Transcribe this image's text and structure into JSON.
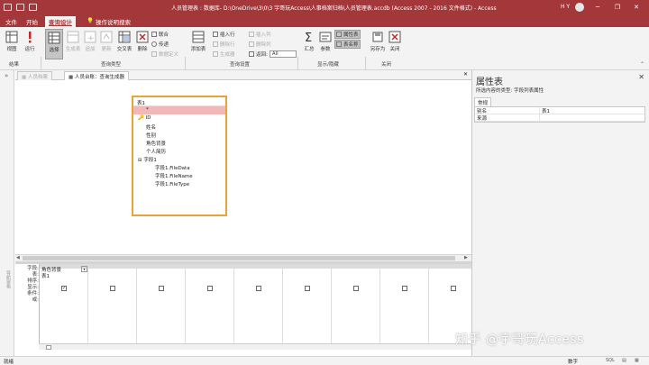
{
  "titlebar": {
    "title": "人员管理表 : 数据库- D:\\OneDrive\\3\\0\\3 宇哥玩Access\\人事档案归档\\人员管理表.accdb (Access 2007 - 2016 文件格式) - Access",
    "user": "H Y",
    "window_buttons": [
      "minimize-icon",
      "restore-icon",
      "close-icon"
    ],
    "accent": "#a4373a"
  },
  "menu_tabs": [
    {
      "label": "文件"
    },
    {
      "label": "开始"
    },
    {
      "label": "查询设计"
    },
    {
      "label": "操作说明搜索"
    }
  ],
  "ribbon": {
    "view_label": "视图",
    "run_label": "运行",
    "select_label": "选择",
    "create_table_label": "生成表",
    "append_label": "追加",
    "update_label": "更新",
    "crosstab_label": "交叉表",
    "delete_label": "删除",
    "union_label": "联合",
    "passthrough_label": "传递",
    "data_definition_label": "数据定义",
    "add_tables_label": "添加表",
    "insert_rows_label": "插入行",
    "delete_rows_label": "删除行",
    "builder_label": "生成器",
    "insert_columns_label": "插入列",
    "delete_columns_label": "删除列",
    "return_label": "返回:",
    "return_value": "All",
    "totals_label": "汇总",
    "parameters_label": "参数",
    "property_sheet_label": "属性表",
    "table_names_label": "表名称",
    "save_as_label": "另存为",
    "close_label": "关闭",
    "groups": [
      "结果",
      "查询类型",
      "查询设置",
      "显示/隐藏",
      "关闭"
    ]
  },
  "nav_pane": {
    "label": "导航窗格"
  },
  "doc_tabs": [
    {
      "label": "人员档案"
    },
    {
      "label": "人员台账：查询生成器"
    }
  ],
  "table_box": {
    "title": "表1",
    "fields": [
      {
        "label": "*"
      },
      {
        "label": "ID"
      },
      {
        "label": "姓名"
      },
      {
        "label": "性别"
      },
      {
        "label": "角色背景"
      },
      {
        "label": "个人简历"
      },
      {
        "label": "字段1"
      },
      {
        "label": "字段1.FileData"
      },
      {
        "label": "字段1.FileName"
      },
      {
        "label": "字段1.FileType"
      }
    ]
  },
  "grid": {
    "row_labels": [
      "字段:",
      "表:",
      "排序:",
      "显示:",
      "条件:",
      "或:"
    ],
    "columns": [
      {
        "field": "角色背景",
        "table": "表1",
        "show": true
      },
      {
        "field": "",
        "table": "",
        "show": false
      },
      {
        "field": "",
        "table": "",
        "show": false
      },
      {
        "field": "",
        "table": "",
        "show": false
      },
      {
        "field": "",
        "table": "",
        "show": false
      },
      {
        "field": "",
        "table": "",
        "show": false
      },
      {
        "field": "",
        "table": "",
        "show": false
      },
      {
        "field": "",
        "table": "",
        "show": false
      },
      {
        "field": "",
        "table": "",
        "show": false
      }
    ]
  },
  "properties": {
    "title": "属性表",
    "selection_type": "所选内容的类型: 字段列表属性",
    "tab": "常规",
    "rows": [
      {
        "key": "别名",
        "value": "表1"
      },
      {
        "key": "来源",
        "value": ""
      }
    ]
  },
  "statusbar": {
    "status": "就绪",
    "numlock": "数字"
  },
  "watermark": "知乎 @宇哥玩Access"
}
